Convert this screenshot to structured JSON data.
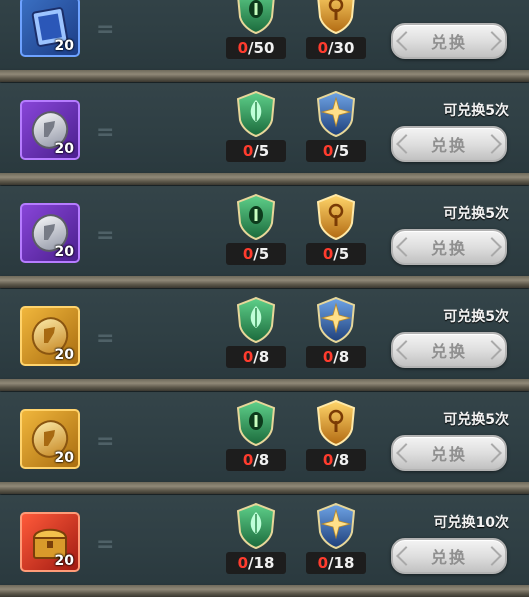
{
  "screen": "exchange-list",
  "icons": {
    "material_1": "green-leaf-shield-emblem",
    "material_2": "star-shield-emblem",
    "material_1_alt": "green-eye-shield-emblem",
    "material_2_alt": "golden-key-shield-emblem"
  },
  "colors": {
    "have_count": "#ff3c2e",
    "need_count": "#f1f1f1",
    "button_text": "#8f8f8f",
    "limit_text": "#f3f3f3"
  },
  "rows": [
    {
      "item_icon": "blue-card-icon",
      "item_count": "20",
      "equals": "=",
      "m1_icon": "green-eye-shield-icon",
      "m1_have": "0",
      "m1_need": "/50",
      "m2_icon": "golden-key-shield-icon",
      "m2_have": "0",
      "m2_need": "/30",
      "limit": "",
      "button": "兑换"
    },
    {
      "item_icon": "purple-silver-coin-icon",
      "item_count": "20",
      "equals": "=",
      "m1_icon": "green-leaf-shield-icon",
      "m1_have": "0",
      "m1_need": "/5",
      "m2_icon": "star-shield-icon",
      "m2_have": "0",
      "m2_need": "/5",
      "limit": "可兑换5次",
      "button": "兑换"
    },
    {
      "item_icon": "purple-silver-coin-icon",
      "item_count": "20",
      "equals": "=",
      "m1_icon": "green-eye-shield-icon",
      "m1_have": "0",
      "m1_need": "/5",
      "m2_icon": "golden-key-shield-icon",
      "m2_have": "0",
      "m2_need": "/5",
      "limit": "可兑换5次",
      "button": "兑换"
    },
    {
      "item_icon": "gold-coin-icon",
      "item_count": "20",
      "equals": "=",
      "m1_icon": "green-leaf-shield-icon",
      "m1_have": "0",
      "m1_need": "/8",
      "m2_icon": "star-shield-icon",
      "m2_have": "0",
      "m2_need": "/8",
      "limit": "可兑换5次",
      "button": "兑换"
    },
    {
      "item_icon": "gold-coin-icon",
      "item_count": "20",
      "equals": "=",
      "m1_icon": "green-eye-shield-icon",
      "m1_have": "0",
      "m1_need": "/8",
      "m2_icon": "golden-key-shield-icon",
      "m2_have": "0",
      "m2_need": "/8",
      "limit": "可兑换5次",
      "button": "兑换"
    },
    {
      "item_icon": "treasure-chest-icon",
      "item_count": "20",
      "equals": "=",
      "m1_icon": "green-leaf-shield-icon",
      "m1_have": "0",
      "m1_need": "/18",
      "m2_icon": "star-shield-icon",
      "m2_have": "0",
      "m2_need": "/18",
      "limit": "可兑换10次",
      "button": "兑换"
    }
  ]
}
